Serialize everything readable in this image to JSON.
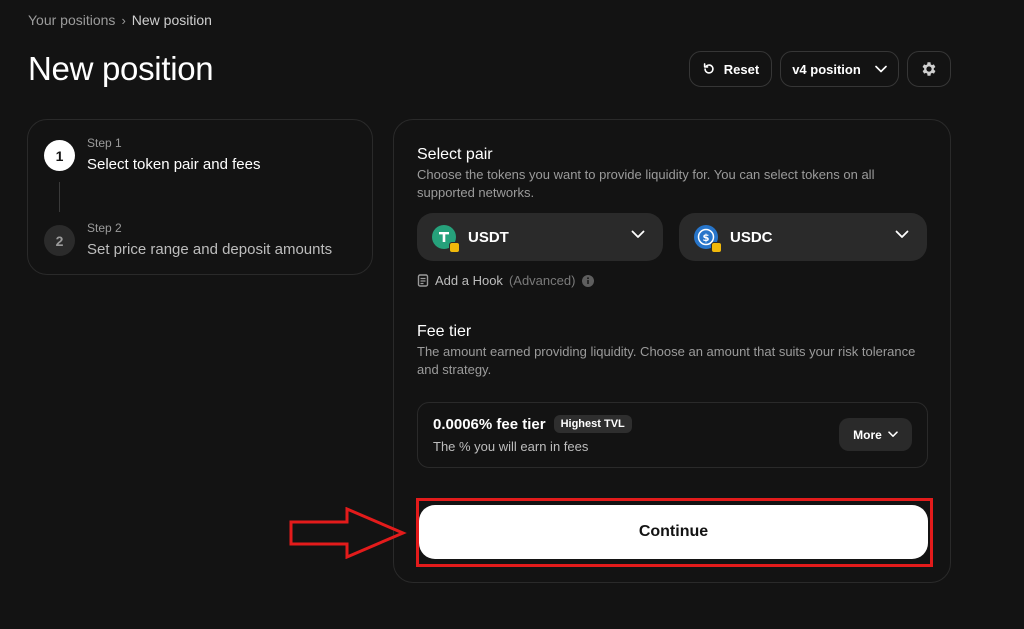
{
  "breadcrumb": {
    "parent": "Your positions",
    "separator": "›",
    "current": "New position"
  },
  "page": {
    "title": "New position"
  },
  "toolbar": {
    "reset_label": "Reset",
    "version_label": "v4 position"
  },
  "steps": [
    {
      "number": "1",
      "label": "Step 1",
      "title": "Select token pair and fees",
      "active": true
    },
    {
      "number": "2",
      "label": "Step 2",
      "title": "Set price range and deposit amounts",
      "active": false
    }
  ],
  "select_pair": {
    "title": "Select pair",
    "description": "Choose the tokens you want to provide liquidity for. You can select tokens on all supported networks.",
    "token_a": {
      "symbol": "USDT",
      "icon": "usdt-icon",
      "color": "#26a17b"
    },
    "token_b": {
      "symbol": "USDC",
      "icon": "usdc-icon",
      "color": "#2775ca"
    },
    "hook_label": "Add a Hook",
    "hook_note": "(Advanced)"
  },
  "fee_tier": {
    "title": "Fee tier",
    "description": "The amount earned providing liquidity. Choose an amount that suits your risk tolerance and strategy.",
    "selected": "0.0006% fee tier",
    "badge": "Highest TVL",
    "subtitle": "The % you will earn in fees",
    "more_label": "More"
  },
  "continue_label": "Continue",
  "colors": {
    "background": "#131313",
    "card_border": "#2a2a2a",
    "annotation_red": "#e31b1b"
  }
}
